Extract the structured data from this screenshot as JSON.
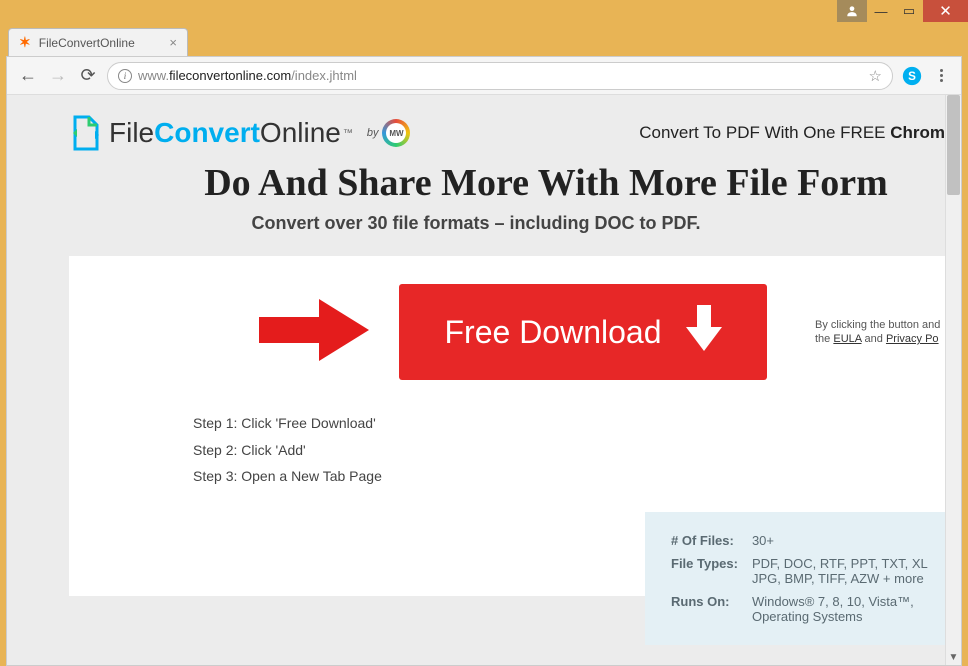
{
  "window": {
    "tab_title": "FileConvertOnline",
    "user_btn": "",
    "minimize": "—",
    "maximize": "▭",
    "close": "✕"
  },
  "toolbar": {
    "url_prefix": "www.",
    "url_domain": "fileconvertonline.com",
    "url_path": "/index.jhtml"
  },
  "page": {
    "logo_file": "File",
    "logo_convert": "Convert",
    "logo_online": "Online",
    "logo_tm": "™",
    "by_label": "by",
    "mw_label": "MW",
    "header_right_prefix": "Convert To PDF With One FREE ",
    "header_right_bold": "Chrom",
    "headline": "Do And Share More With More File Form",
    "subhead": "Convert over 30 file formats – including DOC to PDF.",
    "download_label": "Free Download",
    "legal_prefix": "By clicking the button and",
    "legal_mid": " the ",
    "legal_eula": "EULA",
    "legal_and": " and ",
    "legal_privacy": "Privacy Po",
    "steps": [
      "Step 1: Click 'Free Download'",
      "Step 2: Click 'Add'",
      "Step 3: Open a New Tab Page"
    ],
    "info": {
      "files_label": "# Of Files:",
      "files_value": "30+",
      "types_label": "File Types:",
      "types_value": "PDF, DOC, RTF, PPT, TXT, XL JPG, BMP, TIFF, AZW + more",
      "runs_label": "Runs On:",
      "runs_value": "Windows® 7, 8, 10, Vista™, Operating Systems"
    }
  }
}
